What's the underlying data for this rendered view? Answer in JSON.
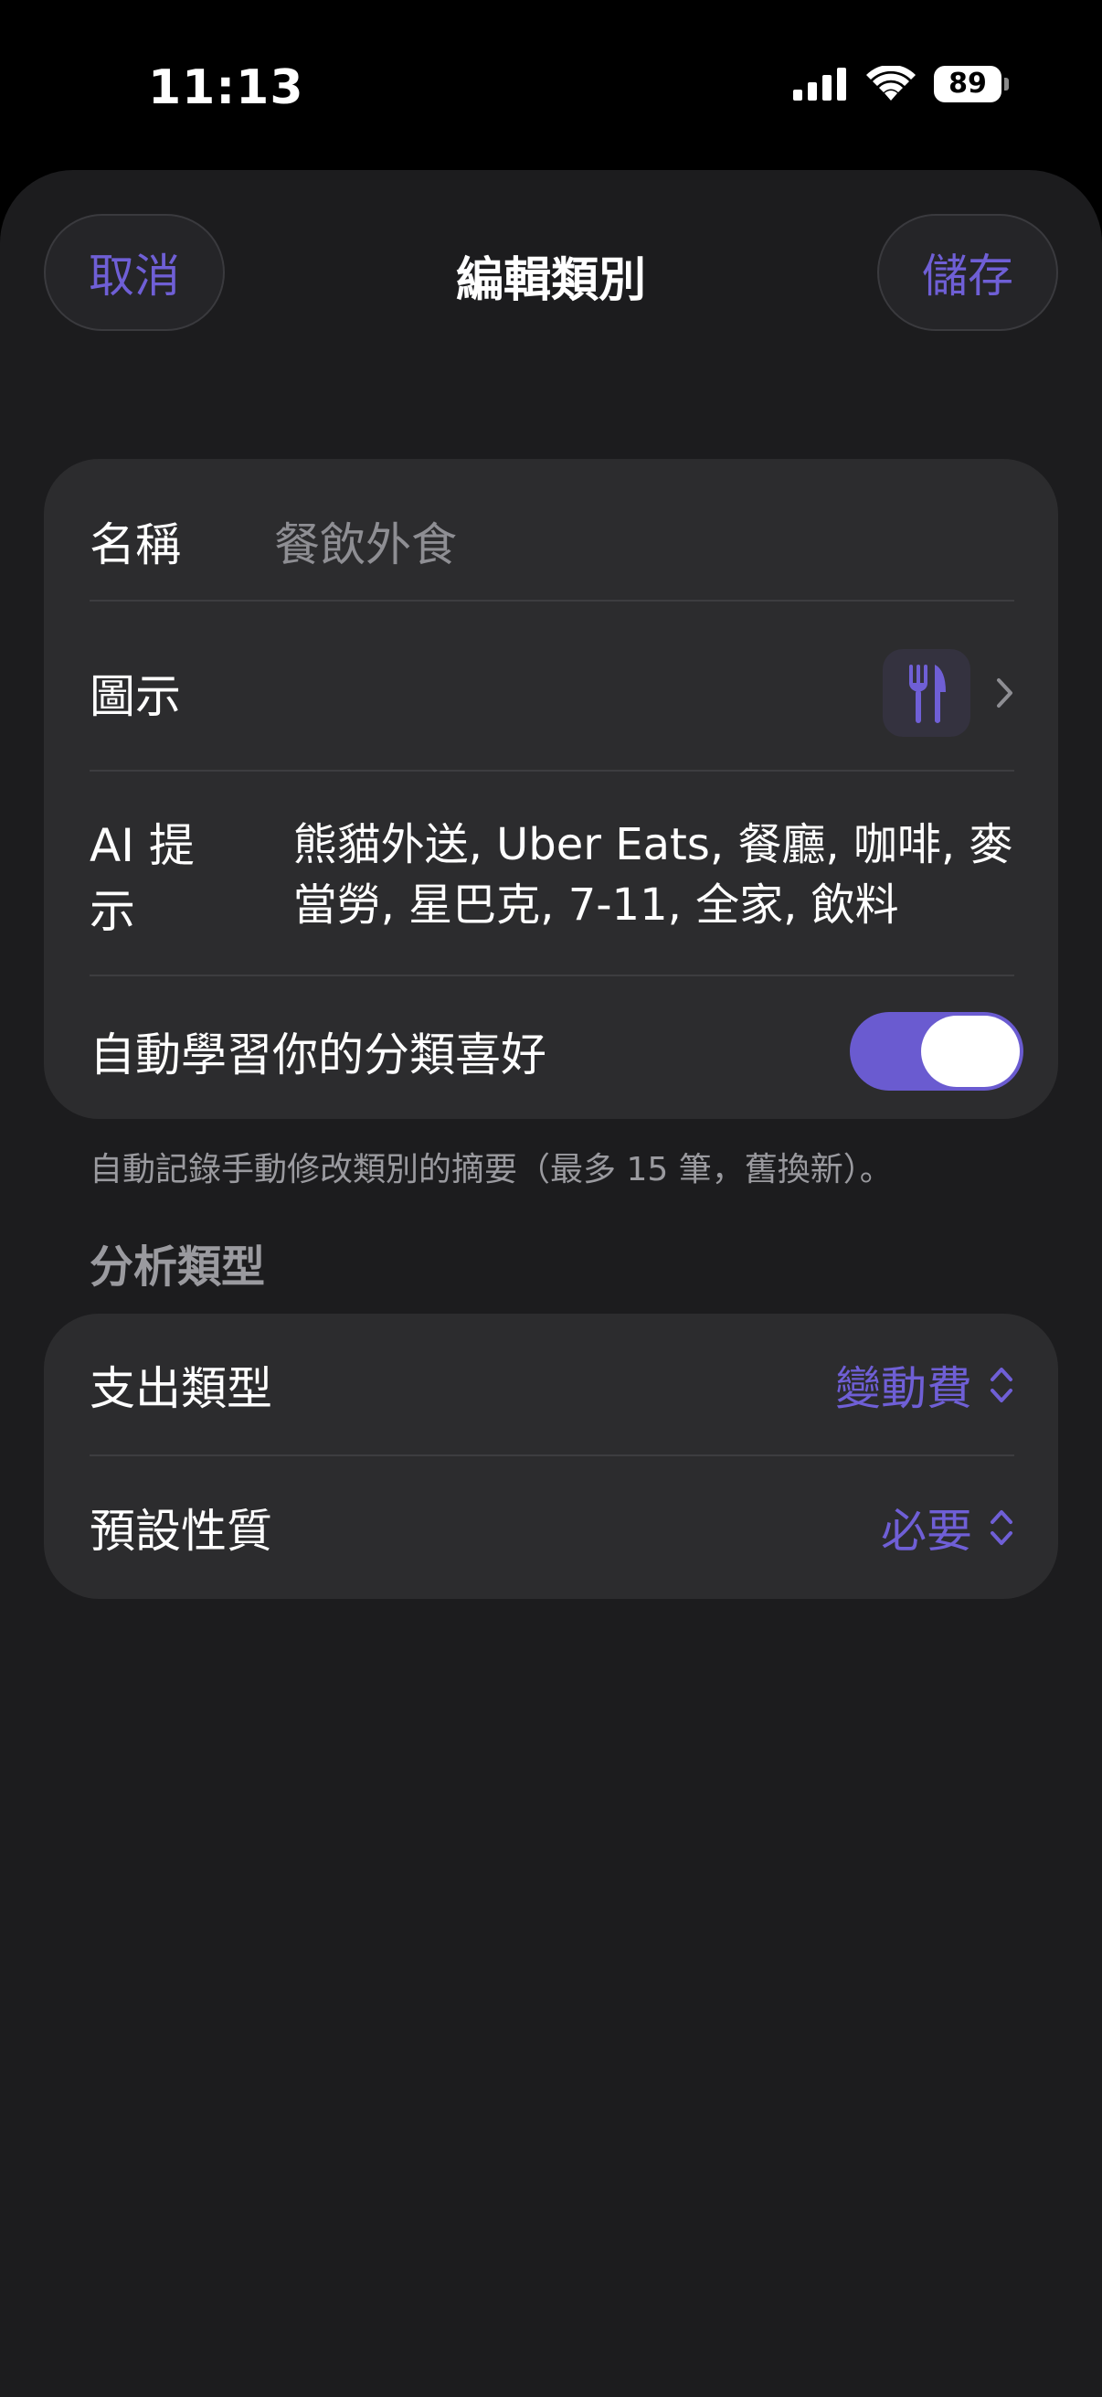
{
  "status_bar": {
    "time": "11:13",
    "battery": "89",
    "icons": [
      "cellular-signal-icon",
      "wifi-icon",
      "battery-icon"
    ]
  },
  "nav": {
    "cancel_label": "取消",
    "title": "編輯類別",
    "save_label": "儲存"
  },
  "form": {
    "name_label": "名稱",
    "name_placeholder": "餐飲外食",
    "icon_label": "圖示",
    "icon_name": "fork-knife-icon",
    "ai_label": "AI 提示",
    "ai_value": "熊貓外送, Uber Eats, 餐廳, 咖啡, 麥當勞, 星巴克, 7-11, 全家, 飲料",
    "auto_learn_label": "自動學習你的分類喜好",
    "auto_learn_on": true
  },
  "footnote": "自動記錄手動修改類別的摘要（最多 15 筆，舊換新）。",
  "analysis": {
    "section_title": "分析類型",
    "expense_type_label": "支出類型",
    "expense_type_value": "變動費",
    "default_nature_label": "預設性質",
    "default_nature_value": "必要"
  },
  "colors": {
    "accent": "#6f5fd6",
    "toggle_on": "#6a5bd0",
    "background": "#1c1c1e",
    "group": "#2c2c2e"
  }
}
